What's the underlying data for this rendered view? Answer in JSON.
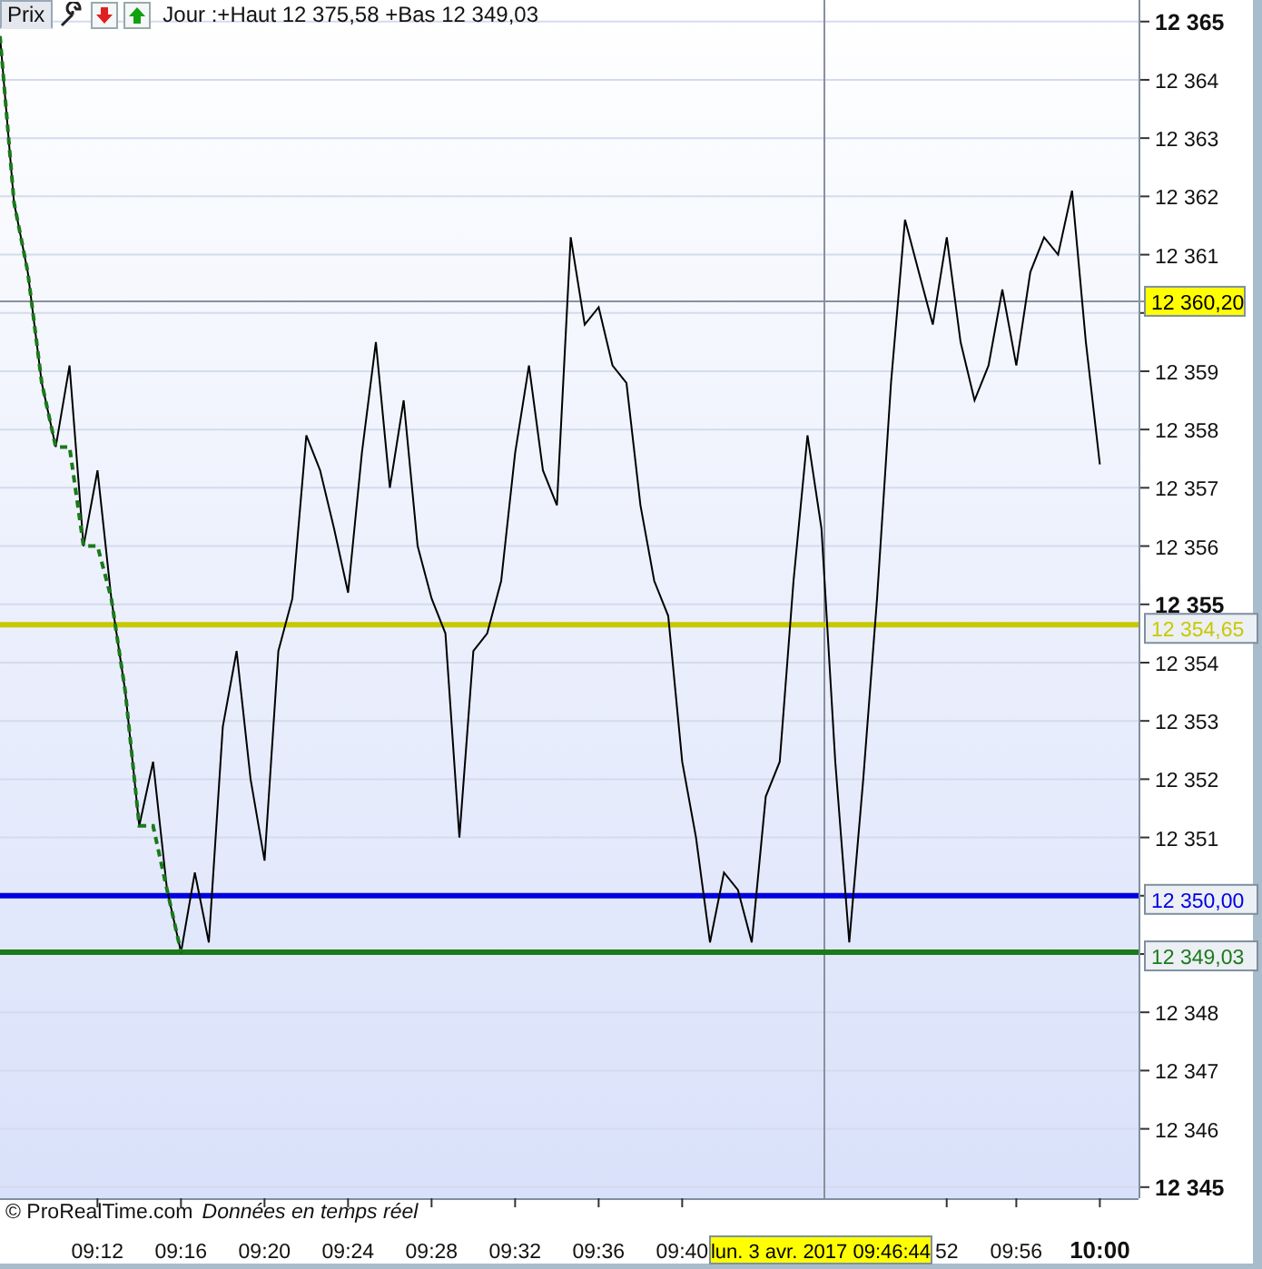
{
  "header": {
    "tab": {
      "label": "Prix",
      "selected": true
    },
    "summary": "Jour :+Haut 12 375,58 +Bas 12 349,03"
  },
  "chart": {
    "chart_data": {
      "type": "line",
      "categories": [
        null,
        null,
        null,
        null,
        null,
        null,
        null,
        "09:12",
        null,
        null,
        null,
        null,
        null,
        "09:16",
        null,
        null,
        null,
        null,
        null,
        "09:20",
        null,
        null,
        null,
        null,
        null,
        "09:24",
        null,
        null,
        null,
        null,
        null,
        "09:28",
        null,
        null,
        null,
        null,
        null,
        "09:32",
        null,
        null,
        null,
        null,
        null,
        "09:36",
        null,
        null,
        null,
        null,
        null,
        "09:40",
        null,
        null,
        null,
        null,
        null,
        null,
        null,
        null,
        null,
        null,
        null,
        null,
        null,
        null,
        null,
        null,
        null,
        null,
        "52",
        null,
        null,
        null,
        null,
        "09:56",
        null,
        null,
        null,
        null,
        null,
        "10:00"
      ],
      "series": [
        {
          "color": "#000000",
          "values": [
            12364.75,
            12361.9,
            12360.7,
            12358.8,
            12357.7,
            12359.1,
            12356.0,
            12357.3,
            12355.1,
            12353.5,
            12351.2,
            12352.3,
            12350.1,
            12349.03,
            12350.4,
            12349.2,
            12352.9,
            12354.2,
            12352.0,
            12350.6,
            12354.2,
            12355.1,
            12357.9,
            12357.3,
            12356.3,
            12355.2,
            12357.6,
            12359.5,
            12357.0,
            12358.5,
            12356.0,
            12355.1,
            12354.5,
            12351.0,
            12354.2,
            12354.5,
            12355.4,
            12357.6,
            12359.1,
            12357.3,
            12356.7,
            12361.3,
            12359.8,
            12360.1,
            12359.1,
            12358.8,
            12356.7,
            12355.4,
            12354.8,
            12352.3,
            12351.0,
            12349.2,
            12350.4,
            12350.1,
            12349.2,
            12351.7,
            12352.3,
            12355.4,
            12357.9,
            12356.3,
            12352.3,
            12349.2,
            12352.0,
            12355.1,
            12358.8,
            12361.6,
            12360.7,
            12359.8,
            12361.3,
            12359.5,
            12358.5,
            12359.1,
            12360.4,
            12359.1,
            12360.7,
            12361.3,
            12361.0,
            12362.1,
            12359.5,
            12357.4
          ]
        },
        {
          "color": "#1a7a1a",
          "line_style": "dashed",
          "values": [
            12364.75,
            12361.9,
            12360.7,
            12358.8,
            12357.7,
            12357.7,
            12356.0,
            12356.0,
            12355.1,
            12353.5,
            12351.2,
            12351.2,
            12350.1,
            12349.03,
            null,
            null,
            null,
            null,
            null,
            null,
            null,
            null,
            null,
            null,
            null,
            null,
            null,
            null,
            null,
            null,
            null,
            null,
            null,
            null,
            null,
            null,
            null,
            null,
            null,
            null,
            null,
            null,
            null,
            null,
            null,
            null,
            null,
            null,
            null,
            null,
            null,
            null,
            null,
            null,
            null,
            null,
            null,
            null,
            null,
            null,
            null,
            null,
            null,
            null,
            null,
            null,
            null,
            null,
            null,
            null,
            null,
            null,
            null,
            null,
            null,
            null,
            null,
            null,
            null,
            null
          ]
        }
      ],
      "ylim": [
        12344.81,
        12365.37
      ],
      "grid": true,
      "yticks": [
        {
          "value": 12365,
          "label": "12 365"
        },
        {
          "value": 12364,
          "label": "12 364"
        },
        {
          "value": 12363,
          "label": "12 363"
        },
        {
          "value": 12362,
          "label": "12 362"
        },
        {
          "value": 12361,
          "label": "12 361"
        },
        {
          "value": 12359,
          "label": "12 359"
        },
        {
          "value": 12358,
          "label": "12 358"
        },
        {
          "value": 12357,
          "label": "12 357"
        },
        {
          "value": 12356,
          "label": "12 356"
        },
        {
          "value": 12355,
          "label": "12 355"
        },
        {
          "value": 12354,
          "label": "12 354"
        },
        {
          "value": 12353,
          "label": "12 353"
        },
        {
          "value": 12352,
          "label": "12 352"
        },
        {
          "value": 12351,
          "label": "12 351"
        },
        {
          "value": 12348,
          "label": "12 348"
        },
        {
          "value": 12347,
          "label": "12 347"
        },
        {
          "value": 12346,
          "label": "12 346"
        },
        {
          "value": 12345,
          "label": "12 345"
        }
      ],
      "ref_lines": [
        {
          "axis": "y",
          "value": 12360.2,
          "label": "12 360,20"
        },
        {
          "axis": "y",
          "value": 12354.65,
          "label": "12 354,65",
          "color": "#c8c800"
        },
        {
          "axis": "y",
          "value": 12350.0,
          "label": "12 350,00",
          "color": "#0000e0"
        },
        {
          "axis": "y",
          "value": 12349.03,
          "label": "12 349,03",
          "color": "#1a7a1a"
        }
      ]
    }
  },
  "cursor": {
    "date_label": "lun. 3 avr. 2017 09:46:44"
  },
  "footer": {
    "copyright": "© ProRealTime.com",
    "note": "Données en temps réel"
  }
}
